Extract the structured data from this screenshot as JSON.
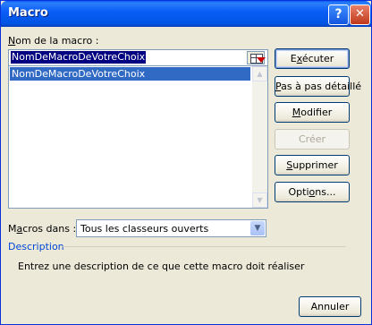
{
  "window": {
    "title": "Macro",
    "help_glyph": "?",
    "close_glyph": "✕"
  },
  "name_field": {
    "label_accel": "N",
    "label_rest": "om de la macro :",
    "value": "NomDeMacroDeVotreChoix"
  },
  "macro_list": {
    "items": [
      "NomDeMacroDeVotreChoix"
    ],
    "selected_index": 0
  },
  "buttons": {
    "run": {
      "pre": "E",
      "accel": "x",
      "post": "écuter"
    },
    "step_into": {
      "pre": "",
      "accel": "P",
      "post": "as à pas détaillé"
    },
    "edit": {
      "pre": "",
      "accel": "M",
      "post": "odifier"
    },
    "create": {
      "label": "Créer",
      "enabled": false
    },
    "delete": {
      "pre": "",
      "accel": "S",
      "post": "upprimer"
    },
    "options": {
      "pre": "Opti",
      "accel": "o",
      "post": "ns..."
    },
    "cancel": {
      "label": "Annuler"
    }
  },
  "macros_in": {
    "label_pre": "M",
    "label_accel": "a",
    "label_post": "cros dans :",
    "value": "Tous les classeurs ouverts"
  },
  "description": {
    "title": "Description",
    "text": "Entrez une description de ce que cette macro doit réaliser"
  },
  "icons": {
    "help": "help-icon",
    "close": "close-icon",
    "reference": "cell-reference-icon",
    "scroll_up": "scroll-up-arrow-icon",
    "scroll_down": "scroll-down-arrow-icon",
    "dropdown": "chevron-down-icon"
  },
  "colors": {
    "titlebar": "#0054e3",
    "selection": "#316ac5",
    "description_title": "#0046d5"
  }
}
